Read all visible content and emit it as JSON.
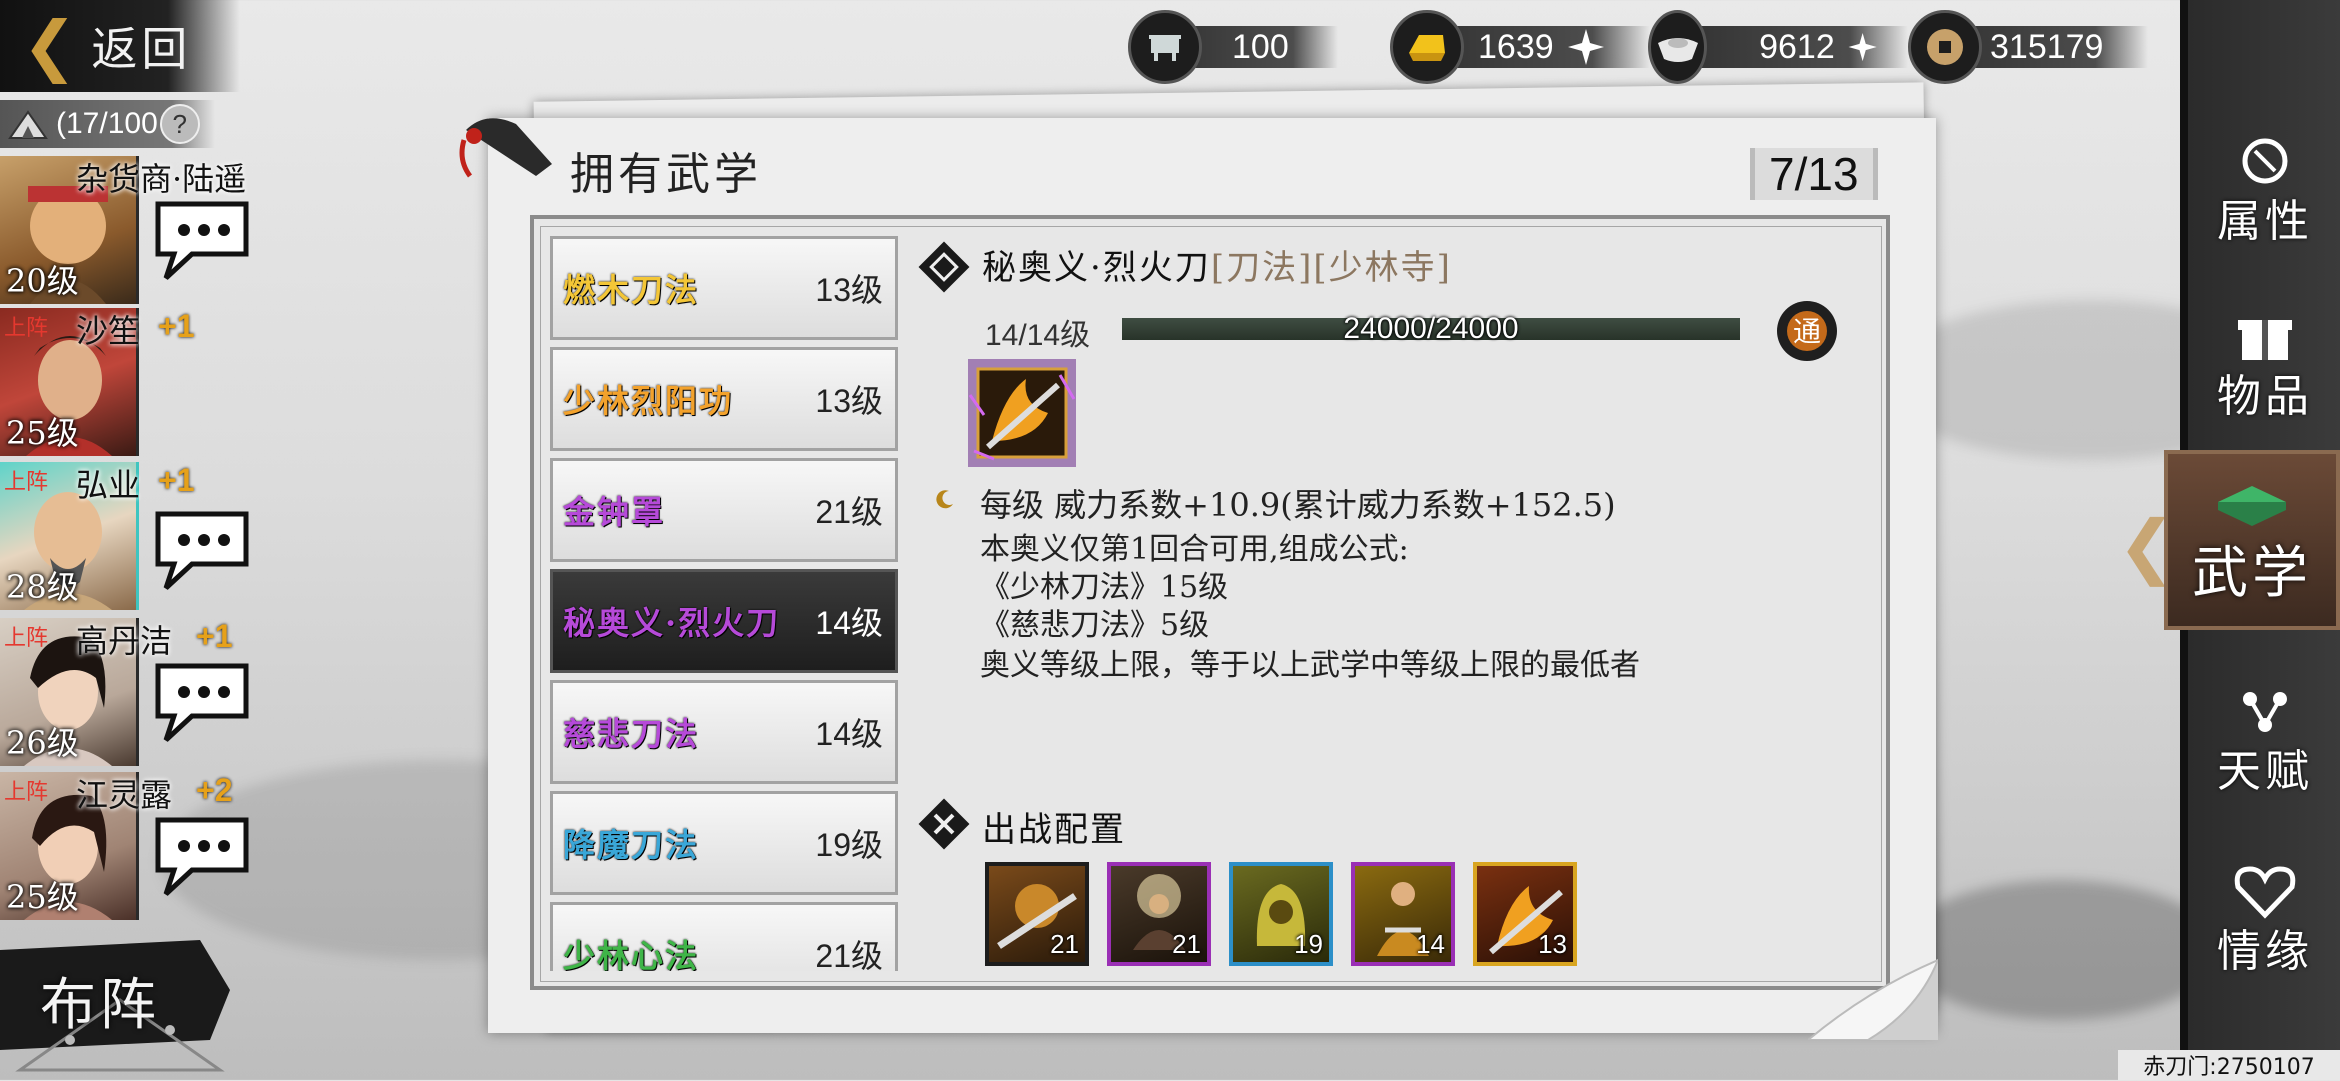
{
  "header": {
    "back_label": "返回",
    "roster_count": "(17/100",
    "help_glyph": "?"
  },
  "currencies": [
    {
      "name": "stamina-tripod",
      "value": "100",
      "has_plus": false
    },
    {
      "name": "gold-ingot",
      "value": "1639",
      "has_plus": true
    },
    {
      "name": "silver-ingot",
      "value": "9612",
      "has_plus": true
    },
    {
      "name": "copper-coin",
      "value": "315179",
      "has_plus": false
    }
  ],
  "party": [
    {
      "name": "杂货商·陆遥",
      "level": "20级",
      "deploy": "",
      "bonus": "",
      "has_chat": true
    },
    {
      "name": "沙笙",
      "level": "25级",
      "deploy": "上阵",
      "bonus": "+1",
      "has_chat": false
    },
    {
      "name": "弘业",
      "level": "28级",
      "deploy": "上阵",
      "bonus": "+1",
      "has_chat": true
    },
    {
      "name": "高丹洁",
      "level": "26级",
      "deploy": "上阵",
      "bonus": "+1",
      "has_chat": true
    },
    {
      "name": "江灵露",
      "level": "25级",
      "deploy": "上阵",
      "bonus": "+2",
      "has_chat": true
    }
  ],
  "formation_label": "布阵",
  "panel": {
    "title": "拥有武学",
    "page_count": "7/13"
  },
  "skills": [
    {
      "name": "燃木刀法",
      "level": "13级",
      "color": "#f3c637",
      "active": false
    },
    {
      "name": "少林烈阳功",
      "level": "13级",
      "color": "#f3a22c",
      "active": false
    },
    {
      "name": "金钟罩",
      "level": "21级",
      "color": "#b64ad9",
      "active": false
    },
    {
      "name": "秘奥义·烈火刀",
      "level": "14级",
      "color": "#b64ad9",
      "active": true
    },
    {
      "name": "慈悲刀法",
      "level": "14级",
      "color": "#b64ad9",
      "active": false
    },
    {
      "name": "降魔刀法",
      "level": "19级",
      "color": "#3aa7d8",
      "active": false
    },
    {
      "name": "少林心法",
      "level": "21级",
      "color": "#3fb548",
      "active": false
    }
  ],
  "detail": {
    "name": "秘奥义·烈火刀",
    "tags": "[刀法][少林寺]",
    "level": "14/14级",
    "xp_text": "24000/24000",
    "xp_fraction": 1.0,
    "tong_badge": "通",
    "lines": [
      "每级  威力系数+10.9(累计威力系数+152.5)",
      "本奥义仅第1回合可用,组成公式:",
      "《少林刀法》15级",
      "《慈悲刀法》5级",
      "奥义等级上限，等于以上武学中等级上限的最低者"
    ]
  },
  "battle": {
    "title": "出战配置",
    "slots": [
      {
        "level": "21",
        "border": "#1d1d1d",
        "tint": "#7a4a1a"
      },
      {
        "level": "21",
        "border": "#9a2fb5",
        "tint": "#3a2a1a"
      },
      {
        "level": "19",
        "border": "#2c8fc8",
        "tint": "#5a5a20"
      },
      {
        "level": "14",
        "border": "#9a2fb5",
        "tint": "#6a4a10"
      },
      {
        "level": "13",
        "border": "#d9a520",
        "tint": "#5a2a10"
      }
    ]
  },
  "nav": [
    {
      "label": "属性",
      "active": false
    },
    {
      "label": "物品",
      "active": false
    },
    {
      "label": "武学",
      "active": true
    },
    {
      "label": "天赋",
      "active": false
    },
    {
      "label": "情缘",
      "active": false
    }
  ],
  "footer_text": "赤刀门:2750107"
}
